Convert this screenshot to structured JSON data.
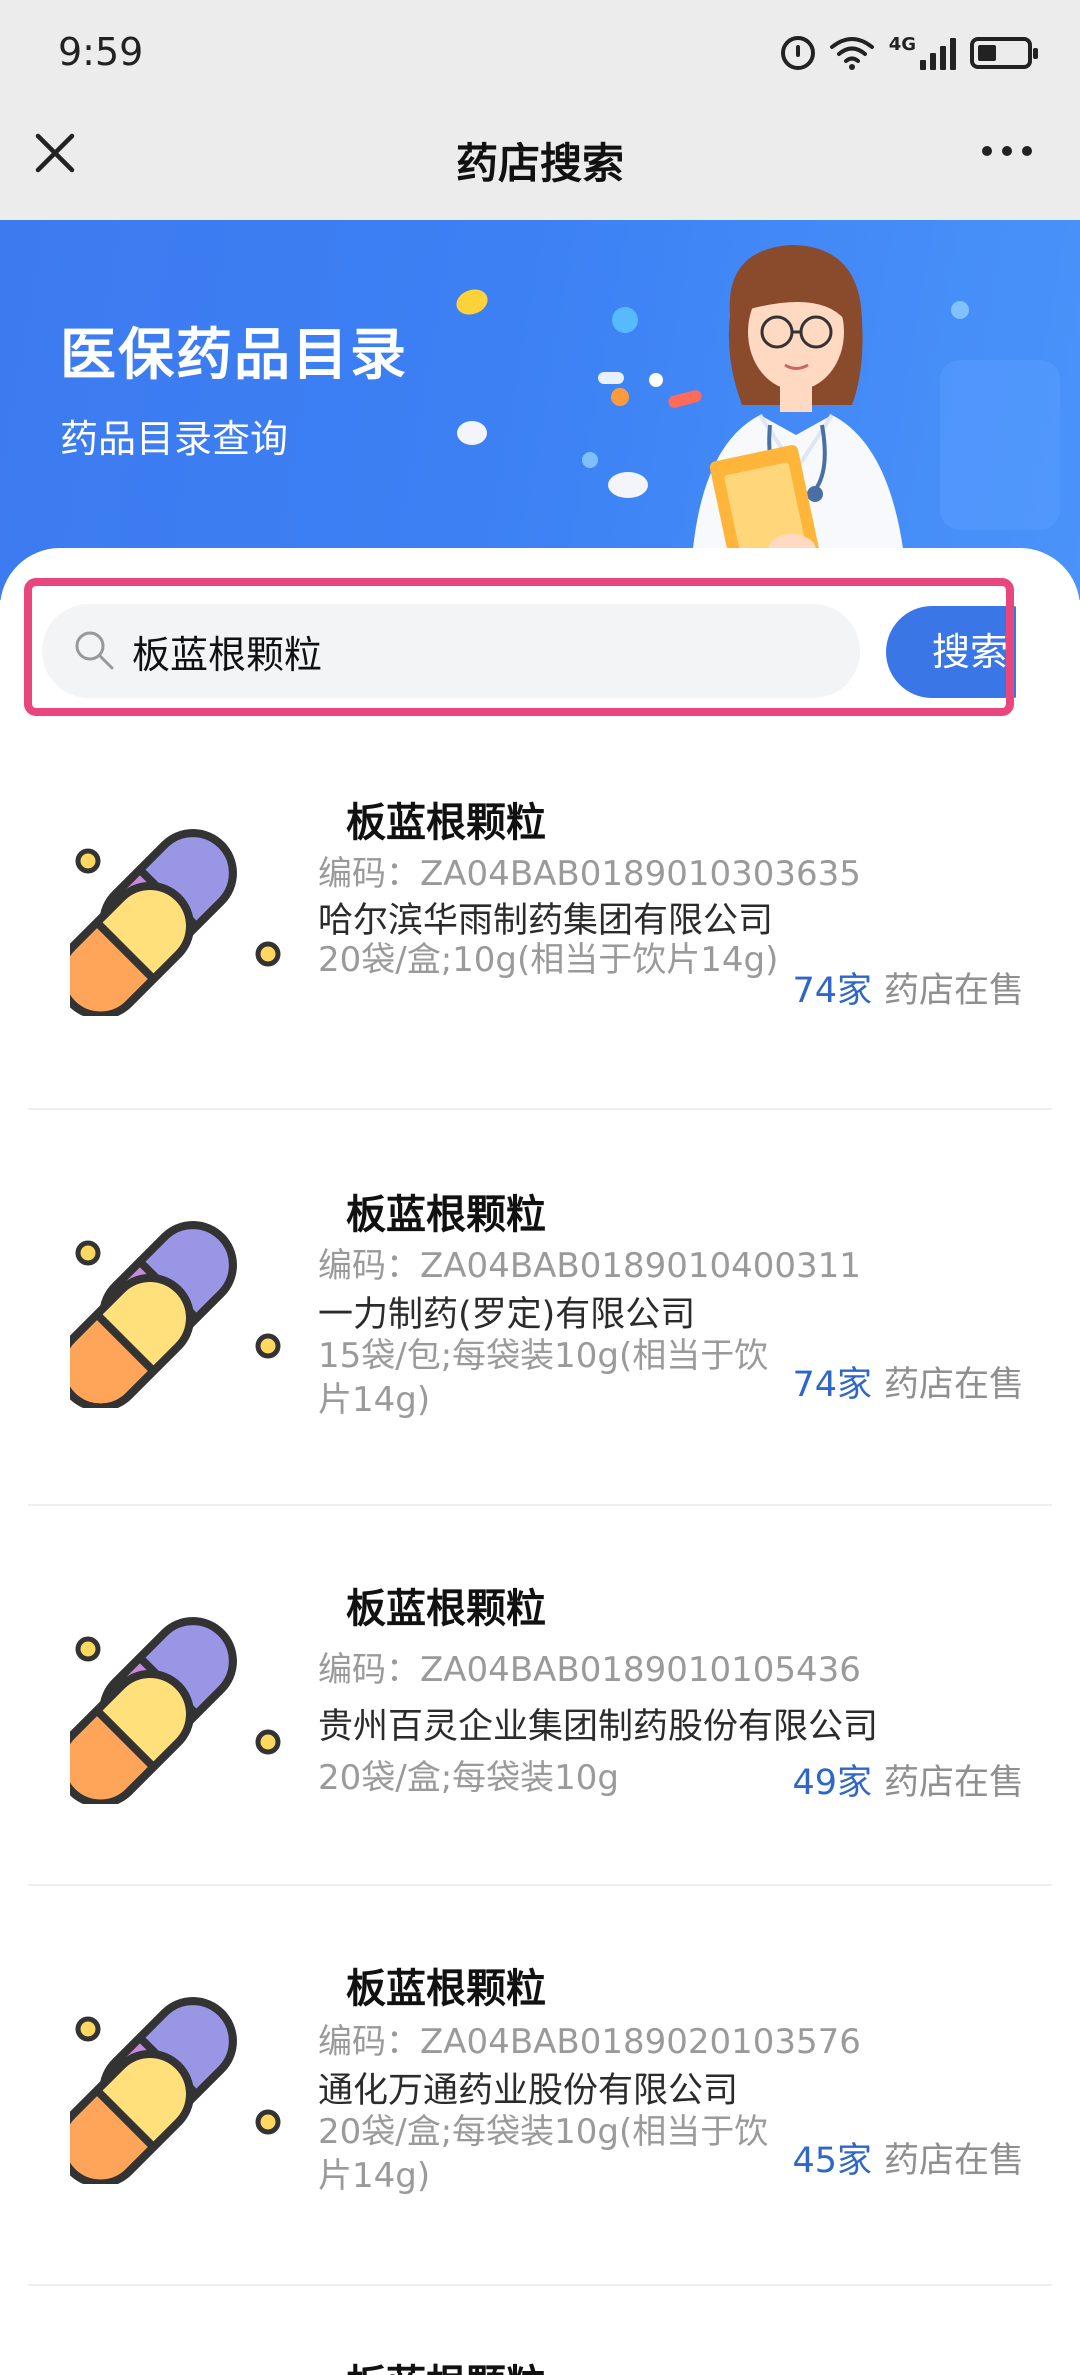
{
  "status_bar": {
    "time": "9:59",
    "network_label": "4G",
    "icons": [
      "alarm-icon",
      "wifi-icon",
      "signal-icon",
      "battery-icon"
    ]
  },
  "nav": {
    "title": "药店搜索",
    "close_icon": "close-icon",
    "more_icon": "more-icon"
  },
  "banner": {
    "title": "医保药品目录",
    "subtitle": "药品目录查询",
    "illustration": "doctor-with-pills"
  },
  "search": {
    "value": "板蓝根颗粒",
    "button_label": "搜索",
    "highlight_color": "#e8467c"
  },
  "colors": {
    "accent": "#3a76e6",
    "banner": "#3d7af0",
    "store_count": "#2f67c8"
  },
  "results": [
    {
      "name": "板蓝根颗粒",
      "code": "编码：ZA04BAB0189010303635",
      "company": "哈尔滨华雨制药集团有限公司",
      "spec": "20袋/盒;10g(相当于饮片14g)",
      "count": "74家",
      "count_suffix": "药店在售"
    },
    {
      "name": "板蓝根颗粒",
      "code": "编码：ZA04BAB0189010400311",
      "company": "一力制药(罗定)有限公司",
      "spec": "15袋/包;每袋装10g(相当于饮片14g)",
      "count": "74家",
      "count_suffix": "药店在售"
    },
    {
      "name": "板蓝根颗粒",
      "code": "编码：ZA04BAB0189010105436",
      "company": "贵州百灵企业集团制药股份有限公司",
      "spec": "20袋/盒;每袋装10g",
      "count": "49家",
      "count_suffix": "药店在售"
    },
    {
      "name": "板蓝根颗粒",
      "code": "编码：ZA04BAB0189020103576",
      "company": "通化万通药业股份有限公司",
      "spec": "20袋/盒;每袋装10g(相当于饮片14g)",
      "count": "45家",
      "count_suffix": "药店在售"
    },
    {
      "name": "板蓝根颗粒"
    }
  ]
}
